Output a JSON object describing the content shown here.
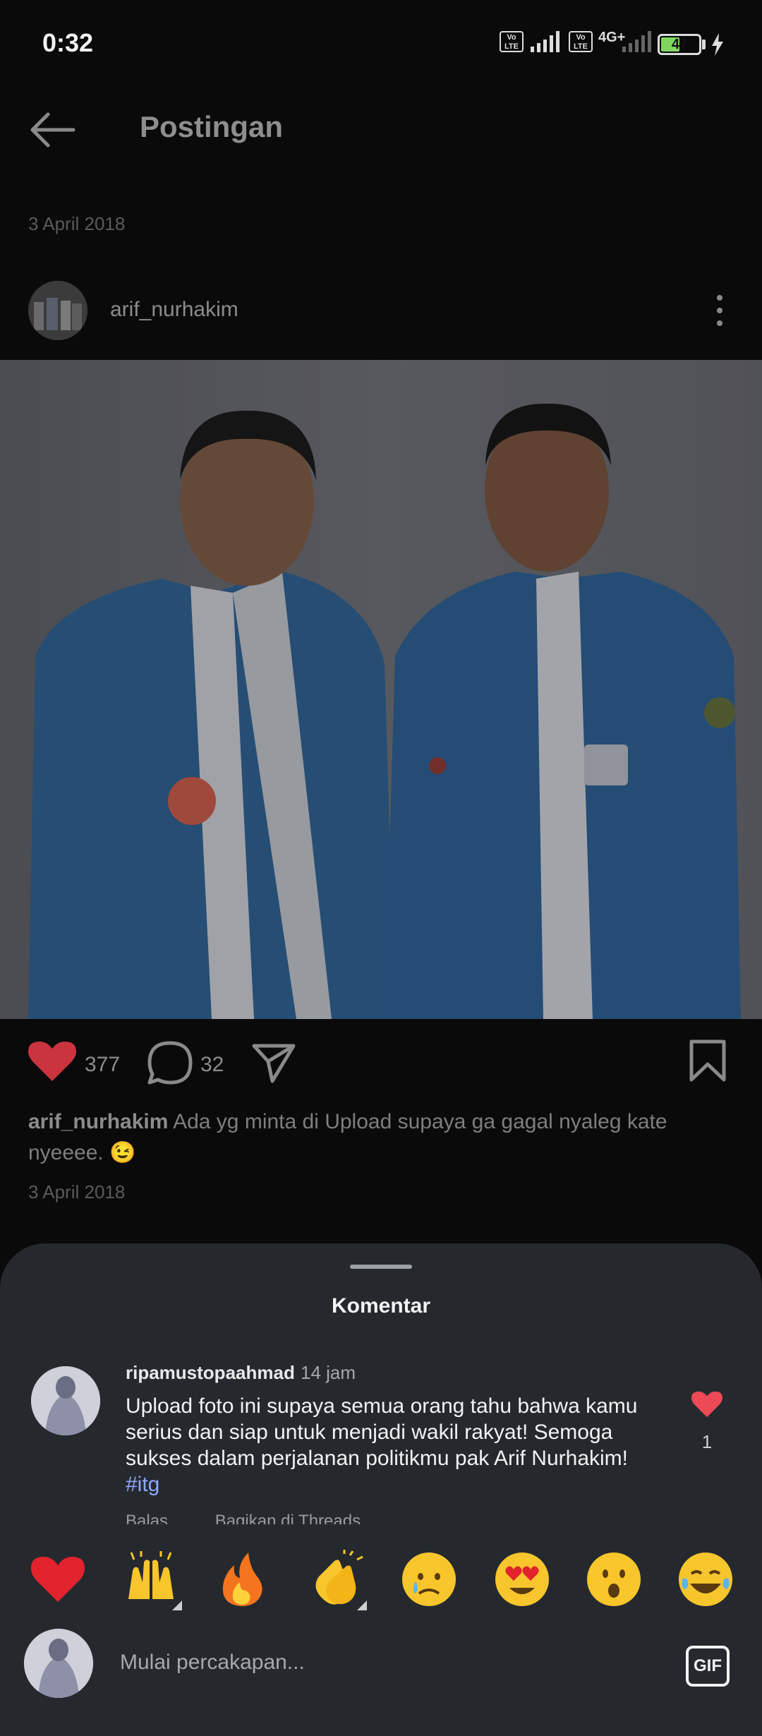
{
  "status_bar": {
    "time": "0:32",
    "network_label": "4G+",
    "volte": "Vo LTE",
    "battery": "47"
  },
  "header": {
    "title": "Postingan"
  },
  "previous_post": {
    "date": "3 April 2018"
  },
  "post": {
    "username": "arif_nurhakim",
    "likes": "377",
    "comments": "32",
    "caption_user": "arif_nurhakim",
    "caption_text": "Ada yg minta di Upload supaya ga gagal nyaleg kate nyeeee. 😉",
    "date": "3 April 2018"
  },
  "comments_sheet": {
    "title": "Komentar",
    "comment": {
      "username": "ripamustopaahmad",
      "time": "14 jam",
      "text": "Upload foto ini supaya semua orang tahu bahwa kamu serius dan siap untuk menjadi wakil rakyat! Semoga sukses dalam perjalanan politikmu pak Arif Nurhakim!",
      "hashtag": "#itg",
      "likes": "1",
      "reply_label": "Balas",
      "share_label": "Bagikan di Threads"
    },
    "quick_reactions": [
      "❤️",
      "🙌",
      "🔥",
      "👏",
      "😢",
      "😍",
      "😮",
      "😂"
    ],
    "input_placeholder": "Mulai percakapan...",
    "gif_label": "GIF"
  },
  "colors": {
    "sheet_bg": "#25292e",
    "like_red": "#ed4956",
    "hashtag": "#8fa8ff"
  },
  "icons": [
    "back-arrow-icon",
    "more-vertical-icon",
    "heart-icon",
    "comment-bubble-icon",
    "share-paper-plane-icon",
    "bookmark-icon",
    "gif-icon"
  ]
}
